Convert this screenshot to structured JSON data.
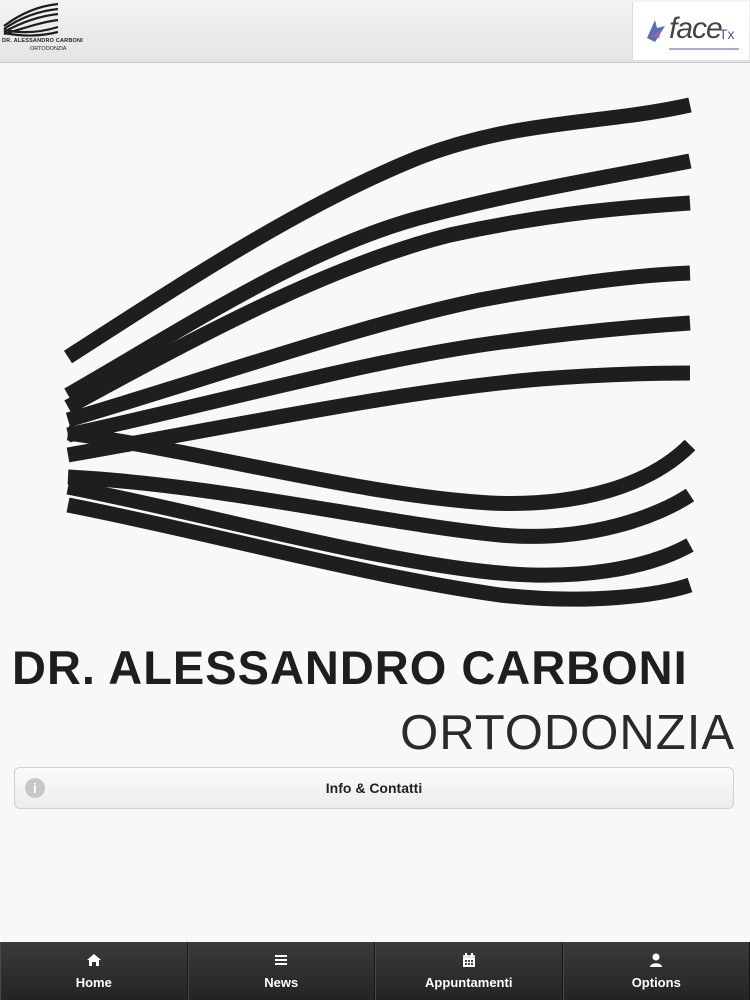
{
  "header": {
    "logo_name": "DR. ALESSANDRO CARBONI",
    "logo_sub": "ORTODONZIA",
    "partner_face": "face",
    "partner_tx": "Tx"
  },
  "brand": {
    "name": "DR. ALESSANDRO CARBONI",
    "subtitle": "ORTODONZIA"
  },
  "info_button": {
    "icon": "info-icon",
    "label": "Info & Contatti"
  },
  "tabs": [
    {
      "label": "Home",
      "icon": "home-icon"
    },
    {
      "label": "News",
      "icon": "list-icon"
    },
    {
      "label": "Appuntamenti",
      "icon": "calendar-icon"
    },
    {
      "label": "Options",
      "icon": "user-icon"
    }
  ],
  "colors": {
    "tabbar": "#2b2b2b",
    "partner_accent": "#6c4a96",
    "logo_stroke": "#1e1e1e"
  }
}
